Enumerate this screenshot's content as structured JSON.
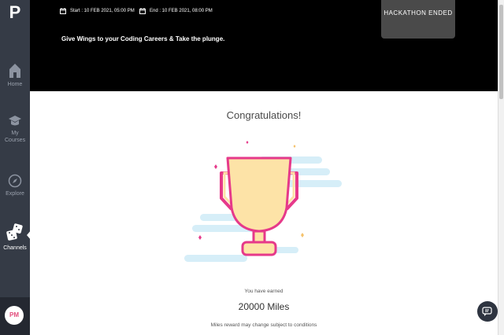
{
  "app": {
    "logo": "P"
  },
  "sidebar": {
    "items": [
      {
        "label": "Home",
        "icon": "home-icon"
      },
      {
        "label": "My Courses",
        "icon": "graduation-cap-icon"
      },
      {
        "label": "Explore",
        "icon": "compass-icon"
      },
      {
        "label": "Channels",
        "icon": "dice-icon",
        "active": true
      }
    ],
    "avatar": "PM"
  },
  "header": {
    "start": "Start : 10 FEB 2021, 05:00 PM",
    "end": "End : 10 FEB 2021, 08:00 PM",
    "tagline": "Give Wings to your Coding Careers & Take the plunge.",
    "status": "HACKATHON ENDED"
  },
  "main": {
    "heading": "Congratulations!",
    "earned_label": "You have earned",
    "miles": "20000 Miles",
    "disclaimer": "Miles reward may change subject to conditions"
  },
  "colors": {
    "sidebar": "#353b46",
    "header": "#000000",
    "trophy_fill": "#fde3a7",
    "trophy_stroke": "#e6398a",
    "cloud": "#d6eef8"
  }
}
